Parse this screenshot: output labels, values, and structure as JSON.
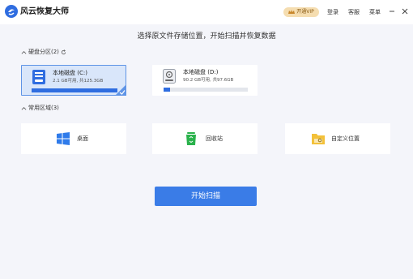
{
  "app": {
    "title": "风云恢复大师"
  },
  "header": {
    "vip_label": "开通VIP",
    "login": "登录",
    "service": "客服",
    "menu": "菜单"
  },
  "main": {
    "title": "选择原文件存储位置，开始扫描并恢复数据"
  },
  "drives_section": {
    "label": "硬盘分区(2)",
    "items": [
      {
        "name": "本地磁盘 (C:)",
        "size": "2.1 GB可用, 共125.3GB",
        "used_fraction": 0.98,
        "selected": true
      },
      {
        "name": "本地磁盘 (D:)",
        "size": "90.2 GB可用, 共97.6GB",
        "used_fraction": 0.08,
        "selected": false
      }
    ]
  },
  "common_section": {
    "label": "常用区域(3)",
    "items": [
      {
        "label": "桌面",
        "icon": "windows-desktop-icon"
      },
      {
        "label": "回收站",
        "icon": "recycle-bin-icon"
      },
      {
        "label": "自定义位置",
        "icon": "folder-icon"
      }
    ]
  },
  "actions": {
    "start_label": "开始扫描"
  },
  "colors": {
    "accent": "#3a7ce7",
    "selected_card": "#d9e6fa",
    "vip_bg": "#f5ddb0",
    "recycle_green": "#2bb24c",
    "folder_yellow": "#f3c13a"
  }
}
